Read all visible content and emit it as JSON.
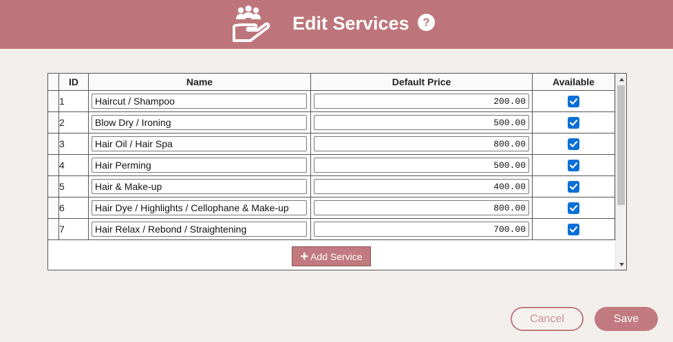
{
  "header": {
    "title": "Edit Services",
    "icon": "service-hand-icon",
    "help_label": "?"
  },
  "table": {
    "columns": {
      "id": "ID",
      "name": "Name",
      "price": "Default Price",
      "available": "Available"
    },
    "rows": [
      {
        "id": "1",
        "name": "Haircut / Shampoo",
        "price": "200.00",
        "available": true
      },
      {
        "id": "2",
        "name": "Blow Dry / Ironing",
        "price": "500.00",
        "available": true
      },
      {
        "id": "3",
        "name": "Hair Oil / Hair Spa",
        "price": "800.00",
        "available": true
      },
      {
        "id": "4",
        "name": "Hair Perming",
        "price": "500.00",
        "available": true
      },
      {
        "id": "5",
        "name": "Hair & Make-up",
        "price": "400.00",
        "available": true
      },
      {
        "id": "6",
        "name": "Hair Dye / Highlights / Cellophane & Make-up",
        "price": "800.00",
        "available": true
      },
      {
        "id": "7",
        "name": "Hair Relax / Rebond / Straightening",
        "price": "700.00",
        "available": true
      }
    ],
    "add_button_label": "Add Service"
  },
  "footer": {
    "cancel_label": "Cancel",
    "save_label": "Save"
  },
  "colors": {
    "brand": "#bd757b",
    "button": "#c17a80",
    "background": "#f2eeeb",
    "checkbox": "#0b6fd6"
  }
}
